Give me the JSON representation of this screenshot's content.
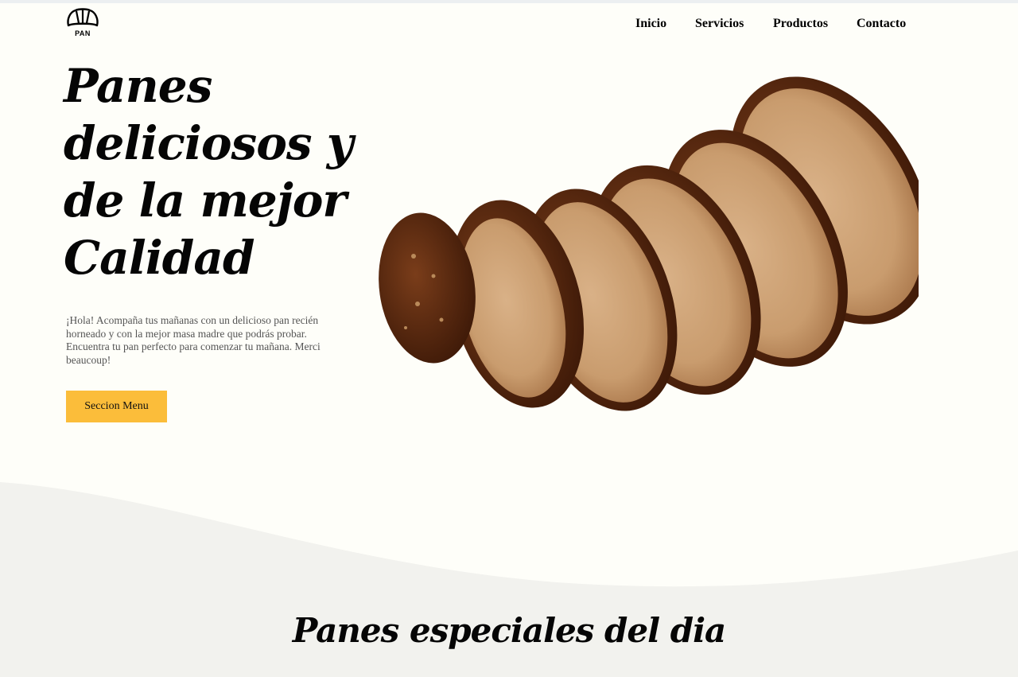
{
  "header": {
    "logo_text": "PAN",
    "nav": [
      "Inicio",
      "Servicios",
      "Productos",
      "Contacto"
    ]
  },
  "hero": {
    "title": "Panes deliciosos y de la mejor Calidad",
    "text": "¡Hola! Acompaña tus mañanas con un delicioso pan recién horneado y con la mejor masa madre que podrás probar. Encuentra tu pan perfecto para comenzar tu mañana. Merci beaucoup!",
    "button_label": "Seccion Menu"
  },
  "section": {
    "title": "Panes especiales del dia"
  },
  "colors": {
    "background": "#fefef9",
    "wave": "#f2f2ee",
    "accent": "#fbbd3a"
  },
  "icons": {
    "logo": "croissant-icon"
  }
}
